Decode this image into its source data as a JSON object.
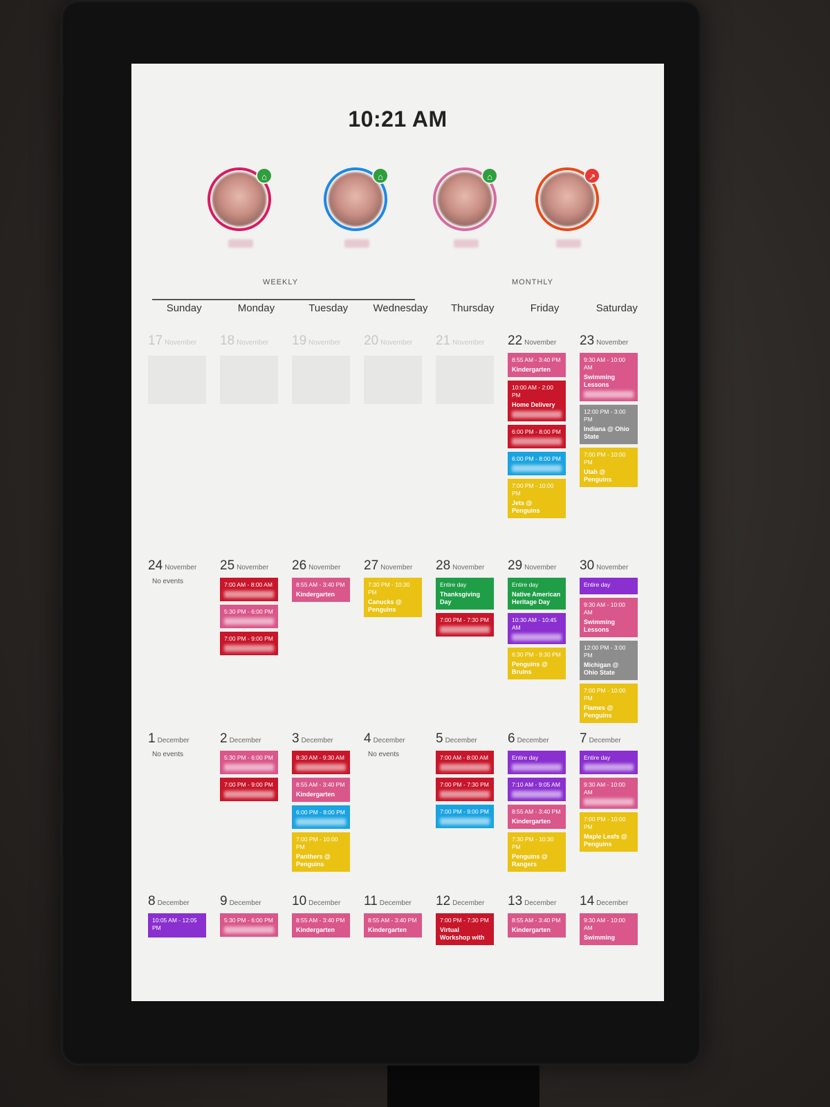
{
  "clock": "10:21 AM",
  "tabs": {
    "weekly": "WEEKLY",
    "monthly": "MONTHLY"
  },
  "people": [
    {
      "ring": "#d81b60",
      "status": "home",
      "status_glyph": "⌂",
      "status_color": "#2e9e3e"
    },
    {
      "ring": "#1e88e5",
      "status": "home",
      "status_glyph": "⌂",
      "status_color": "#2e9e3e"
    },
    {
      "ring": "#d36ba0",
      "status": "home",
      "status_glyph": "⌂",
      "status_color": "#2e9e3e"
    },
    {
      "ring": "#e64a19",
      "status": "away",
      "status_glyph": "↗",
      "status_color": "#e53935"
    }
  ],
  "days": [
    "Sunday",
    "Monday",
    "Tuesday",
    "Wednesday",
    "Thursday",
    "Friday",
    "Saturday"
  ],
  "weeks": [
    [
      {
        "num": "17",
        "month": "November",
        "past": true
      },
      {
        "num": "18",
        "month": "November",
        "past": true
      },
      {
        "num": "19",
        "month": "November",
        "past": true
      },
      {
        "num": "20",
        "month": "November",
        "past": true
      },
      {
        "num": "21",
        "month": "November",
        "past": true
      },
      {
        "num": "22",
        "month": "November",
        "events": [
          {
            "color": "pink",
            "time": "8:55 AM - 3:40 PM",
            "title": "Kindergarten"
          },
          {
            "color": "red",
            "time": "10:00 AM - 2:00 PM",
            "title": "Home Delivery",
            "blur": true
          },
          {
            "color": "red",
            "time": "6:00 PM - 8:00 PM",
            "title": "",
            "blur": true
          },
          {
            "color": "blue",
            "time": "6:00 PM - 8:00 PM",
            "title": "",
            "blur": true
          },
          {
            "color": "yellow",
            "time": "7:00 PM - 10:00 PM",
            "title": "Jets @ Penguins"
          }
        ]
      },
      {
        "num": "23",
        "month": "November",
        "events": [
          {
            "color": "pink",
            "time": "9:30 AM - 10:00 AM",
            "title": "Swimming Lessons",
            "blur": true
          },
          {
            "color": "gray",
            "time": "12:00 PM - 3:00 PM",
            "title": "Indiana @ Ohio State"
          },
          {
            "color": "yellow",
            "time": "7:00 PM - 10:00 PM",
            "title": "Utah @ Penguins"
          }
        ]
      }
    ],
    [
      {
        "num": "24",
        "month": "November",
        "noevents": "No events"
      },
      {
        "num": "25",
        "month": "November",
        "events": [
          {
            "color": "red",
            "time": "7:00 AM - 8:00 AM",
            "title": "",
            "blur": true
          },
          {
            "color": "pink",
            "time": "5:30 PM - 6:00 PM",
            "title": "",
            "blur": true
          },
          {
            "color": "red",
            "time": "7:00 PM - 9:00 PM",
            "title": "",
            "blur": true
          }
        ]
      },
      {
        "num": "26",
        "month": "November",
        "events": [
          {
            "color": "pink",
            "time": "8:55 AM - 3:40 PM",
            "title": "Kindergarten"
          }
        ]
      },
      {
        "num": "27",
        "month": "November",
        "events": [
          {
            "color": "yellow",
            "time": "7:30 PM - 10:30 PM",
            "title": "Canucks @ Penguins"
          }
        ]
      },
      {
        "num": "28",
        "month": "November",
        "events": [
          {
            "color": "green",
            "time": "Entire day",
            "title": "Thanksgiving Day"
          },
          {
            "color": "red",
            "time": "7:00 PM - 7:30 PM",
            "title": "",
            "blur": true
          }
        ]
      },
      {
        "num": "29",
        "month": "November",
        "events": [
          {
            "color": "green",
            "time": "Entire day",
            "title": "Native American Heritage Day"
          },
          {
            "color": "purple",
            "time": "10:30 AM - 10:45 AM",
            "title": "",
            "blur": true
          },
          {
            "color": "yellow",
            "time": "6:30 PM - 9:30 PM",
            "title": "Penguins @ Bruins"
          }
        ]
      },
      {
        "num": "30",
        "month": "November",
        "events": [
          {
            "color": "purple",
            "time": "Entire day",
            "title": ""
          },
          {
            "color": "pink",
            "time": "9:30 AM - 10:00 AM",
            "title": "Swimming Lessons"
          },
          {
            "color": "gray",
            "time": "12:00 PM - 3:00 PM",
            "title": "Michigan @ Ohio State"
          },
          {
            "color": "yellow",
            "time": "7:00 PM - 10:00 PM",
            "title": "Flames @ Penguins"
          }
        ]
      }
    ],
    [
      {
        "num": "1",
        "month": "December",
        "noevents": "No events"
      },
      {
        "num": "2",
        "month": "December",
        "events": [
          {
            "color": "pink",
            "time": "5:30 PM - 6:00 PM",
            "title": "",
            "blur": true
          },
          {
            "color": "red",
            "time": "7:00 PM - 9:00 PM",
            "title": "",
            "blur": true
          }
        ]
      },
      {
        "num": "3",
        "month": "December",
        "events": [
          {
            "color": "red",
            "time": "8:30 AM - 9:30 AM",
            "title": "",
            "blur": true
          },
          {
            "color": "pink",
            "time": "8:55 AM - 3:40 PM",
            "title": "Kindergarten"
          },
          {
            "color": "blue",
            "time": "6:00 PM - 8:00 PM",
            "title": "",
            "blur": true
          },
          {
            "color": "yellow",
            "time": "7:00 PM - 10:00 PM",
            "title": "Panthers @ Penguins"
          }
        ]
      },
      {
        "num": "4",
        "month": "December",
        "noevents": "No events"
      },
      {
        "num": "5",
        "month": "December",
        "events": [
          {
            "color": "red",
            "time": "7:00 AM - 8:00 AM",
            "title": "",
            "blur": true
          },
          {
            "color": "red",
            "time": "7:00 PM - 7:30 PM",
            "title": "",
            "blur": true
          },
          {
            "color": "blue",
            "time": "7:00 PM - 9:00 PM",
            "title": "",
            "blur": true
          }
        ]
      },
      {
        "num": "6",
        "month": "December",
        "events": [
          {
            "color": "purple",
            "time": "Entire day",
            "title": "",
            "blur": true
          },
          {
            "color": "purple",
            "time": "7:10 AM - 9:05 AM",
            "title": "",
            "blur": true
          },
          {
            "color": "pink",
            "time": "8:55 AM - 3:40 PM",
            "title": "Kindergarten"
          },
          {
            "color": "yellow",
            "time": "7:30 PM - 10:30 PM",
            "title": "Penguins @ Rangers"
          }
        ]
      },
      {
        "num": "7",
        "month": "December",
        "events": [
          {
            "color": "purple",
            "time": "Entire day",
            "title": "",
            "blur": true
          },
          {
            "color": "pink",
            "time": "9:30 AM - 10:00 AM",
            "title": "",
            "blur": true
          },
          {
            "color": "yellow",
            "time": "7:00 PM - 10:00 PM",
            "title": "Maple Leafs @ Penguins"
          }
        ]
      }
    ],
    [
      {
        "num": "8",
        "month": "December",
        "events": [
          {
            "color": "purple",
            "time": "10:05 AM - 12:05 PM",
            "title": ""
          }
        ]
      },
      {
        "num": "9",
        "month": "December",
        "events": [
          {
            "color": "pink",
            "time": "5:30 PM - 6:00 PM",
            "title": "",
            "blur": true
          }
        ]
      },
      {
        "num": "10",
        "month": "December",
        "events": [
          {
            "color": "pink",
            "time": "8:55 AM - 3:40 PM",
            "title": "Kindergarten"
          }
        ]
      },
      {
        "num": "11",
        "month": "December",
        "events": [
          {
            "color": "pink",
            "time": "8:55 AM - 3:40 PM",
            "title": "Kindergarten"
          }
        ]
      },
      {
        "num": "12",
        "month": "December",
        "events": [
          {
            "color": "red",
            "time": "7:00 PM - 7:30 PM",
            "title": "Virtual Workshop with"
          }
        ]
      },
      {
        "num": "13",
        "month": "December",
        "events": [
          {
            "color": "pink",
            "time": "8:55 AM - 3:40 PM",
            "title": "Kindergarten"
          }
        ]
      },
      {
        "num": "14",
        "month": "December",
        "events": [
          {
            "color": "pink",
            "time": "9:30 AM - 10:00 AM",
            "title": "Swimming"
          }
        ]
      }
    ]
  ]
}
